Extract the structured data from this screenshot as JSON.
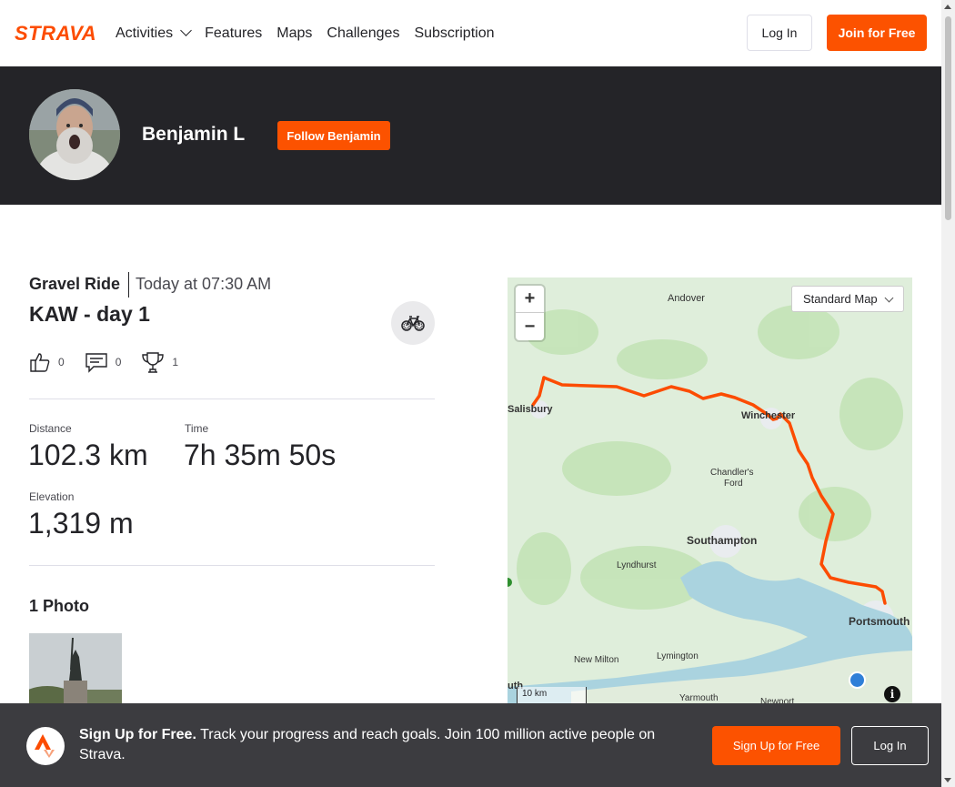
{
  "nav": {
    "logo": "STRAVA",
    "links": [
      "Activities",
      "Features",
      "Maps",
      "Challenges",
      "Subscription"
    ],
    "login_label": "Log In",
    "join_label": "Join for Free"
  },
  "athlete": {
    "name": "Benjamin L",
    "follow_label": "Follow Benjamin"
  },
  "activity": {
    "type": "Gravel Ride",
    "time": "Today at 07:30 AM",
    "name": "KAW - day 1",
    "kudos": "0",
    "comments": "0",
    "achievements": "1",
    "stats": {
      "distance_label": "Distance",
      "distance": "102.3 km",
      "time_label": "Time",
      "time": "7h 35m 50s",
      "elevation_label": "Elevation",
      "elevation": "1,319 m"
    },
    "photos_title": "1 Photo"
  },
  "map": {
    "zoom_in": "+",
    "zoom_out": "−",
    "style_selected": "Standard Map",
    "scale": "10 km",
    "route_color": "#fc4c02",
    "places": [
      "Andover",
      "Salisbury",
      "Winchester",
      "Chandler's",
      "Ford",
      "Southampton",
      "Lyndhurst",
      "Portsmouth",
      "New Milton",
      "Lymington",
      "Yarmouth",
      "Newport",
      "uth"
    ]
  },
  "signup_bar": {
    "headline": "Sign Up for Free.",
    "text": "Track your progress and reach goals. Join 100 million active people on Strava.",
    "signup_label": "Sign Up for Free",
    "login_label": "Log In"
  },
  "colors": {
    "brand": "#fc5200",
    "banner": "#242428",
    "bar": "#3c3c40"
  }
}
